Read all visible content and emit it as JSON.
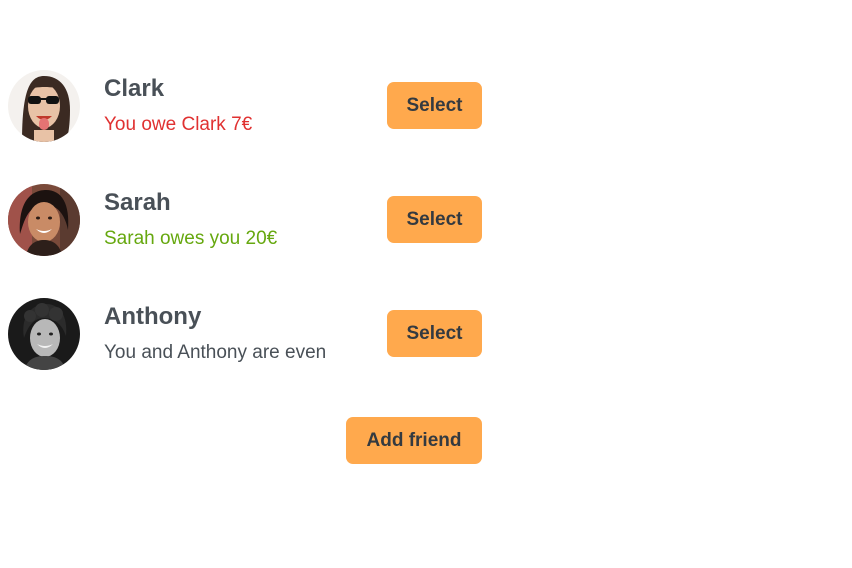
{
  "friends": [
    {
      "name": "Clark",
      "balance_text": "You owe Clark 7€",
      "balance_status": "owe",
      "select_label": "Select",
      "avatar_icon": "avatar-clark"
    },
    {
      "name": "Sarah",
      "balance_text": "Sarah owes you 20€",
      "balance_status": "owed",
      "select_label": "Select",
      "avatar_icon": "avatar-sarah"
    },
    {
      "name": "Anthony",
      "balance_text": "You and Anthony are even",
      "balance_status": "even",
      "select_label": "Select",
      "avatar_icon": "avatar-anthony"
    }
  ],
  "add_friend_label": "Add friend",
  "colors": {
    "button_bg": "#ffa94d",
    "button_text": "#343a40",
    "text": "#495057",
    "owe": "#e03131",
    "owed": "#66a80f"
  }
}
